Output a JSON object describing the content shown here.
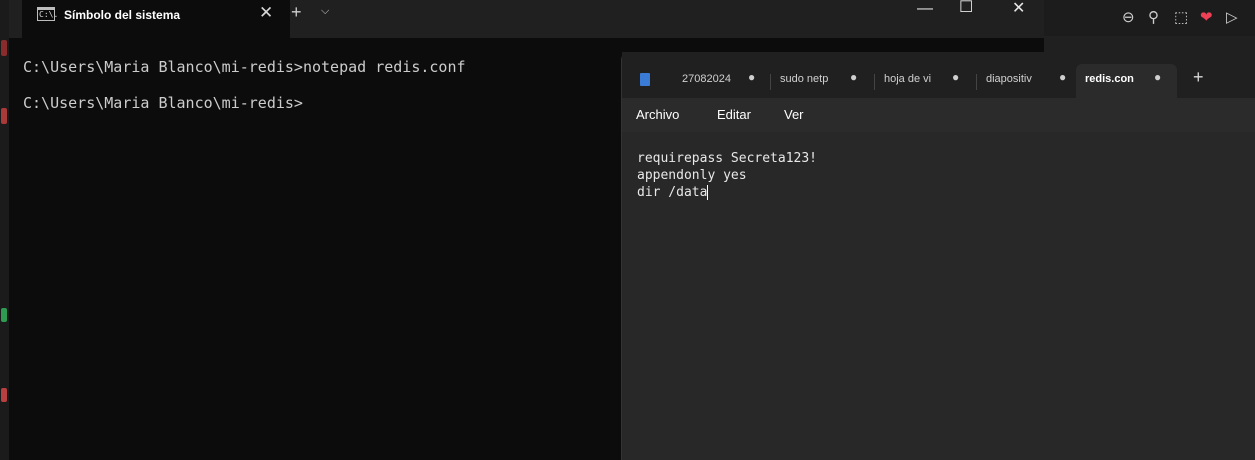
{
  "terminal": {
    "tab_title": "Símbolo del sistema",
    "tab_icon_text": "C:\\.",
    "close_glyph": "✕",
    "new_tab_glyph": "+",
    "dropdown_glyph": "⌵",
    "window_controls": {
      "minimize": "—",
      "maximize": "☐",
      "close": "✕"
    },
    "lines": [
      "C:\\Users\\Maria Blanco\\mi-redis>notepad redis.conf",
      "C:\\Users\\Maria Blanco\\mi-redis>"
    ]
  },
  "browser_toolbar": {
    "icons": [
      "zoom-out-icon",
      "pin-icon",
      "screenshot-icon",
      "pocket-icon",
      "send-icon"
    ],
    "glyphs": {
      "zoom": "⊖",
      "pin": "⚲",
      "screenshot": "⬚",
      "pocket": "❤",
      "send": "▷"
    },
    "pocket_color": "#ef4056"
  },
  "notepad": {
    "tabs": [
      {
        "label": "27082024",
        "active": false
      },
      {
        "label": "sudo netp",
        "active": false
      },
      {
        "label": "hoja de vi",
        "active": false
      },
      {
        "label": "diapositiv",
        "active": false
      },
      {
        "label": "redis.con",
        "active": true
      }
    ],
    "unsaved_dot": "●",
    "new_tab_glyph": "+",
    "menu": {
      "file": "Archivo",
      "edit": "Editar",
      "view": "Ver"
    },
    "content": [
      "requirepass Secreta123!",
      "appendonly yes",
      "dir /data"
    ]
  },
  "colors": {
    "terminal_bg": "#0c0c0c",
    "terminal_text": "#cccccc",
    "notepad_bg": "#282828",
    "accent_blue": "#3a7bd5"
  }
}
